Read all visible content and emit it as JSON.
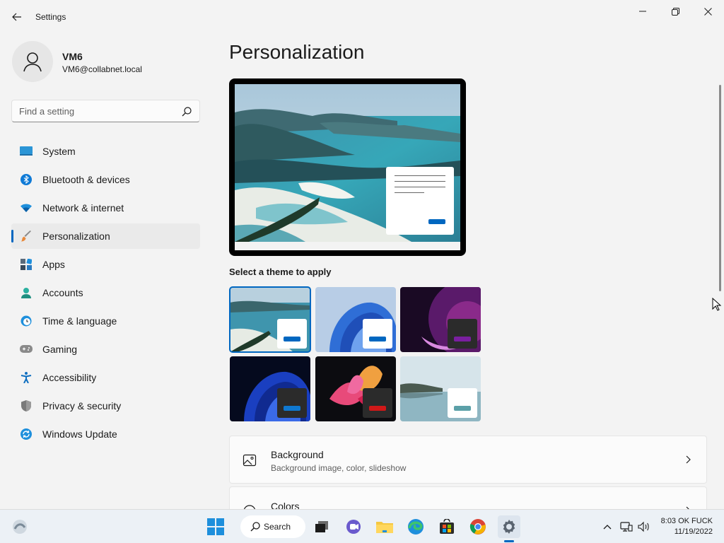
{
  "window": {
    "app_title": "Settings",
    "controls": [
      "minimize-icon",
      "restore-icon",
      "close-icon"
    ]
  },
  "user": {
    "name": "VM6",
    "email": "VM6@collabnet.local"
  },
  "search": {
    "placeholder": "Find a setting"
  },
  "nav": {
    "items": [
      {
        "label": "System",
        "icon": "system-icon"
      },
      {
        "label": "Bluetooth & devices",
        "icon": "bluetooth-icon"
      },
      {
        "label": "Network & internet",
        "icon": "wifi-icon"
      },
      {
        "label": "Personalization",
        "icon": "paintbrush-icon",
        "selected": true
      },
      {
        "label": "Apps",
        "icon": "apps-icon"
      },
      {
        "label": "Accounts",
        "icon": "person-icon"
      },
      {
        "label": "Time & language",
        "icon": "clock-globe-icon"
      },
      {
        "label": "Gaming",
        "icon": "gamepad-icon"
      },
      {
        "label": "Accessibility",
        "icon": "accessibility-icon"
      },
      {
        "label": "Privacy & security",
        "icon": "shield-icon"
      },
      {
        "label": "Windows Update",
        "icon": "update-icon"
      }
    ]
  },
  "main": {
    "title": "Personalization",
    "theme_section_label": "Select a theme to apply",
    "themes": [
      {
        "name": "theme-1",
        "selected": true
      },
      {
        "name": "theme-2"
      },
      {
        "name": "theme-3"
      },
      {
        "name": "theme-4"
      },
      {
        "name": "theme-5"
      },
      {
        "name": "theme-6"
      }
    ],
    "cards": [
      {
        "title": "Background",
        "subtitle": "Background image, color, slideshow",
        "icon": "image-icon"
      },
      {
        "title": "Colors",
        "subtitle": "",
        "icon": "palette-icon"
      }
    ]
  },
  "taskbar": {
    "search_label": "Search",
    "time": "8:03 OK FUCK",
    "date": "11/19/2022",
    "accent": "#0067c0"
  }
}
